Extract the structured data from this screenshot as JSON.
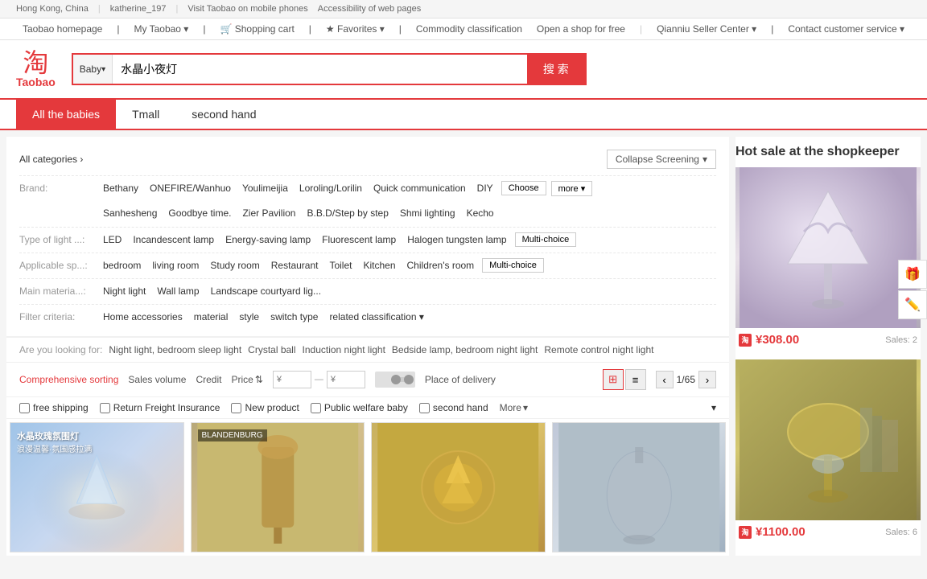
{
  "topbar": {
    "location": "Hong Kong, China",
    "user": "katherine_197",
    "mobile": "Visit Taobao on mobile phones",
    "accessibility": "Accessibility of web pages"
  },
  "navbar": {
    "items": [
      "Taobao homepage",
      "My Taobao",
      "Shopping cart",
      "Favorites",
      "Commodity classification",
      "Open a shop for free",
      "Qianniu Seller Center",
      "Contact customer service"
    ]
  },
  "header": {
    "logo_icon": "淘",
    "logo_text": "Taobao",
    "search_category": "Baby",
    "search_value": "水晶小夜灯",
    "search_btn": "搜 索"
  },
  "tabs": {
    "items": [
      "All the babies",
      "Tmall",
      "second hand"
    ],
    "active": 0
  },
  "filter": {
    "collapse_label": "Collapse Screening",
    "all_categories": "All categories",
    "brand_label": "Brand:",
    "brand_items": [
      "Bethany",
      "ONEFIRE/Wanhuo",
      "Youlimeijia",
      "Loroling/Lorilin",
      "Quick communication",
      "DIY"
    ],
    "brand_more_items": [
      "Sanhesheng",
      "Goodbye time.",
      "Zier Pavilion",
      "B.B.D/Step by step",
      "Shmi lighting",
      "Kecho"
    ],
    "brand_choose": "Choose",
    "brand_more": "more",
    "light_type_label": "Type of light ...:",
    "light_type_items": [
      "LED",
      "Incandescent lamp",
      "Energy-saving lamp",
      "Fluorescent lamp",
      "Halogen tungsten lamp"
    ],
    "light_type_btn": "Multi-choice",
    "applicable_label": "Applicable sp...:",
    "applicable_items": [
      "bedroom",
      "living room",
      "Study room",
      "Restaurant",
      "Toilet",
      "Kitchen",
      "Children's room"
    ],
    "applicable_btn": "Multi-choice",
    "material_label": "Main materia...:",
    "material_items": [
      "Night light",
      "Wall lamp",
      "Landscape courtyard lig..."
    ],
    "criteria_label": "Filter criteria:",
    "criteria_items": [
      "Home accessories",
      "material",
      "style",
      "switch type",
      "related classification"
    ]
  },
  "suggestions": {
    "label": "Are you looking for:",
    "items": [
      "Night light, bedroom sleep light",
      "Crystal ball",
      "Induction night light",
      "Bedside lamp, bedroom night light",
      "Remote control night light"
    ]
  },
  "sort": {
    "items": [
      "Comprehensive sorting",
      "Sales volume",
      "Credit",
      "Price"
    ],
    "active": 0,
    "price_from": "¥",
    "price_to": "¥",
    "delivery_label": "Place of delivery",
    "page_current": "1",
    "page_total": "65"
  },
  "checkboxes": {
    "items": [
      "free shipping",
      "Return Freight Insurance",
      "New product",
      "Public welfare baby",
      "second hand"
    ],
    "more": "More"
  },
  "products": [
    {
      "id": 1,
      "title": "水晶玫瑰氛围灯",
      "subtitle": "浪漫温馨·氛围感拉满",
      "color_class": "p1"
    },
    {
      "id": 2,
      "title": "BLANDENBURG",
      "subtitle": "",
      "color_class": "p2"
    },
    {
      "id": 3,
      "title": "",
      "subtitle": "",
      "color_class": "p3"
    },
    {
      "id": 4,
      "title": "",
      "subtitle": "",
      "color_class": "p4"
    }
  ],
  "hot_sale": {
    "header": "Hot sale at the shopkeeper",
    "products": [
      {
        "price": "¥308.00",
        "sales": "Sales: 2",
        "color_class": "hot-img-1"
      },
      {
        "price": "¥1100.00",
        "sales": "Sales: 6",
        "color_class": "hot-img-2"
      }
    ]
  }
}
